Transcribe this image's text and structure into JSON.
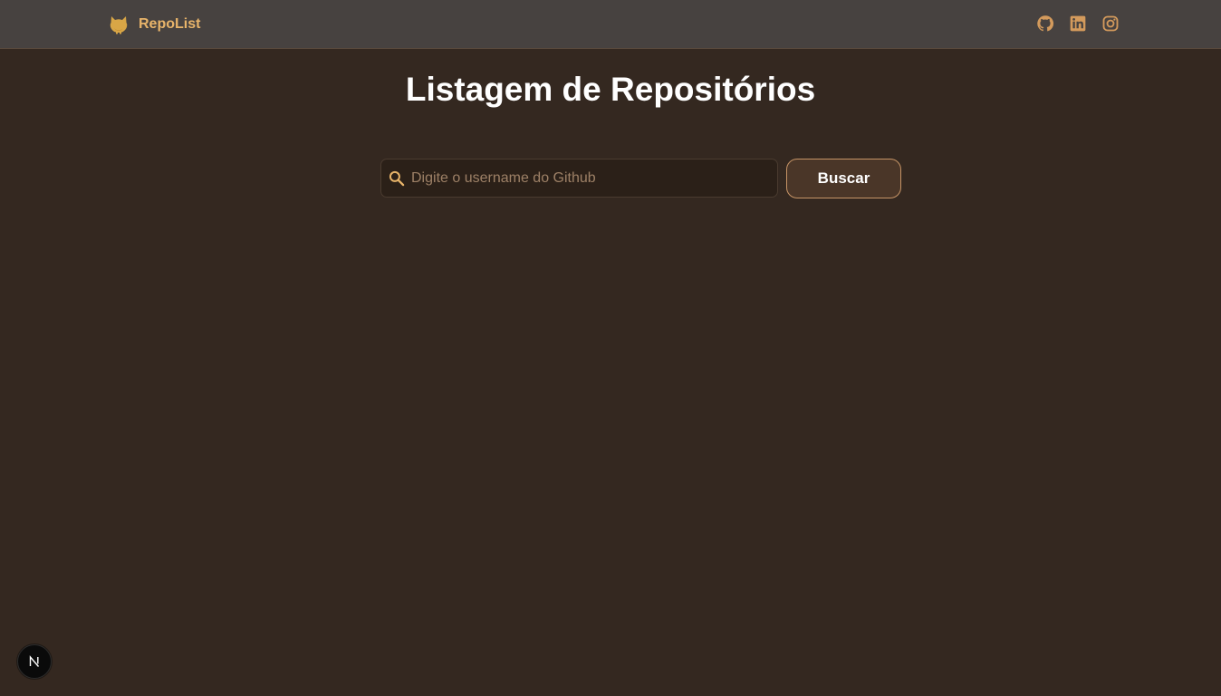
{
  "navbar": {
    "brand_name": "RepoList",
    "brand_icon": "github-octocat-icon",
    "social_links": [
      {
        "name": "github",
        "icon": "github-icon"
      },
      {
        "name": "linkedin",
        "icon": "linkedin-icon"
      },
      {
        "name": "instagram",
        "icon": "instagram-icon"
      }
    ]
  },
  "main": {
    "title": "Listagem de Repositórios",
    "search": {
      "placeholder": "Digite o username do Github",
      "value": "",
      "icon": "search-icon"
    },
    "search_button_label": "Buscar"
  },
  "dev_badge": {
    "letter": "N",
    "icon": "nextjs-icon"
  },
  "colors": {
    "background": "#342820",
    "navbar": "#474240",
    "accent": "#e8b46a",
    "button_bg": "#4a3628",
    "button_border": "#c69466"
  }
}
